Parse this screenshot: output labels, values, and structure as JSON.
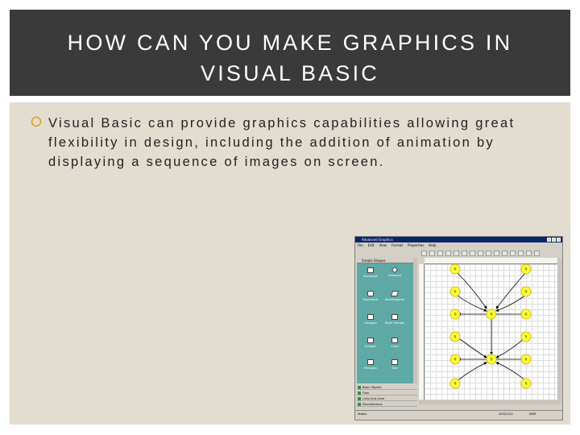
{
  "slide": {
    "title": "HOW CAN YOU MAKE GRAPHICS IN\nVISUAL BASIC",
    "bullet": "Visual Basic can provide graphics capabilities allowing great flexibility in design, including the addition of animation by displaying a sequence of images on screen."
  },
  "app": {
    "window_title": "Advanced Graphics",
    "menu": [
      "File",
      "Edit",
      "View",
      "Format",
      "Properties",
      "Help"
    ],
    "palette_title": "Simple Shapes",
    "shapes": [
      {
        "label": "Rectangle"
      },
      {
        "label": "Diamond"
      },
      {
        "label": "Rounded R"
      },
      {
        "label": "Parallelogram"
      },
      {
        "label": "Hexagon"
      },
      {
        "label": "Right Triangle"
      },
      {
        "label": "Octagon"
      },
      {
        "label": "Cross"
      },
      {
        "label": "Pentagon"
      },
      {
        "label": "Tabs"
      }
    ],
    "palette_list": [
      "Basic Objects",
      "Flow",
      "Links And Lines",
      "Miscellaneous"
    ],
    "node_label": "N",
    "status": {
      "left": "Status",
      "date": "2002/11/1",
      "mode": "NUM"
    }
  },
  "colors": {
    "title_bg": "#3a3a3a",
    "content_bg": "#e3ddd1",
    "bullet_icon": "#d9a21b",
    "palette_bg": "#5fa9a6",
    "node_fill": "#ffff33"
  }
}
